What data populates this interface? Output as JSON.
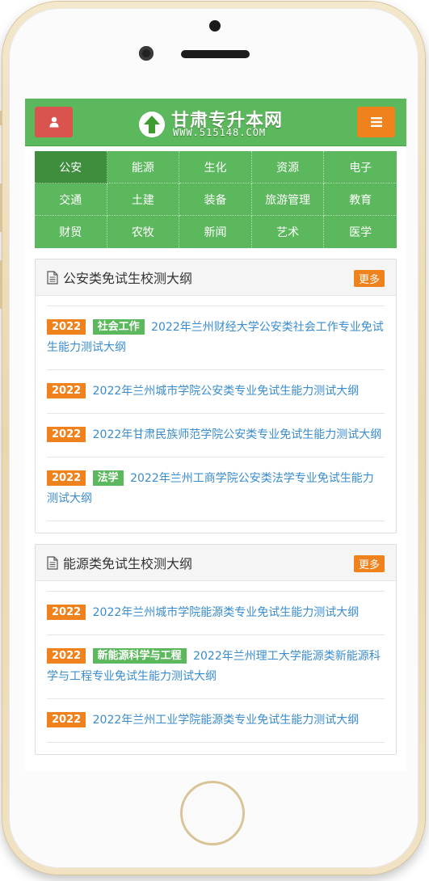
{
  "header": {
    "title": "甘肃专升本网",
    "subtitle": "WWW.515148.COM",
    "user_icon": "user-icon",
    "menu_icon": "hamburger-menu-icon",
    "colors": {
      "green": "#5cb85c",
      "red": "#d9534f",
      "orange": "#f0821e"
    }
  },
  "nav": {
    "items": [
      {
        "label": "公安",
        "active": true
      },
      {
        "label": "能源"
      },
      {
        "label": "生化"
      },
      {
        "label": "资源"
      },
      {
        "label": "电子"
      },
      {
        "label": "交通"
      },
      {
        "label": "土建"
      },
      {
        "label": "装备"
      },
      {
        "label": "旅游管理"
      },
      {
        "label": "教育"
      },
      {
        "label": "财贸"
      },
      {
        "label": "农牧"
      },
      {
        "label": "新闻"
      },
      {
        "label": "艺术"
      },
      {
        "label": "医学"
      }
    ]
  },
  "panels": [
    {
      "title": "公安类免试生校测大纲",
      "more_label": "更多",
      "items": [
        {
          "year": "2022",
          "tag": "社会工作",
          "text": "2022年兰州财经大学公安类社会工作专业免试生能力测试大纲"
        },
        {
          "year": "2022",
          "text": "2022年兰州城市学院公安类专业免试生能力测试大纲"
        },
        {
          "year": "2022",
          "text": "2022年甘肃民族师范学院公安类专业免试生能力测试大纲"
        },
        {
          "year": "2022",
          "tag": "法学",
          "text": "2022年兰州工商学院公安类法学专业免试生能力测试大纲"
        }
      ]
    },
    {
      "title": "能源类免试生校测大纲",
      "more_label": "更多",
      "items": [
        {
          "year": "2022",
          "text": "2022年兰州城市学院能源类专业免试生能力测试大纲"
        },
        {
          "year": "2022",
          "tag": "新能源科学与工程",
          "text": "2022年兰州理工大学能源类新能源科学与工程专业免试生能力测试大纲"
        },
        {
          "year": "2022",
          "text": "2022年兰州工业学院能源类专业免试生能力测试大纲"
        }
      ]
    }
  ]
}
